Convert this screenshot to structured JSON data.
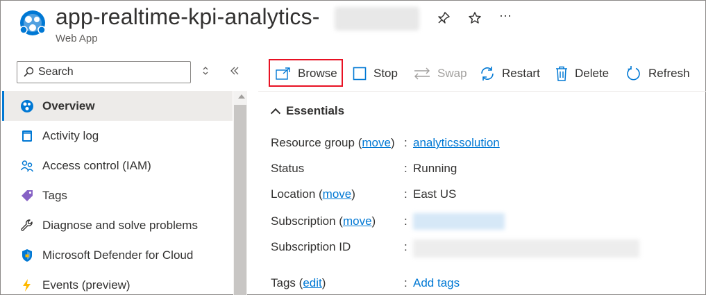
{
  "header": {
    "title": "app-realtime-kpi-analytics-",
    "subtitle": "Web App",
    "pin_icon": "pin-icon",
    "star_icon": "star-icon",
    "more_icon": "ellipsis-icon",
    "more_glyph": "···"
  },
  "sidebar": {
    "search_placeholder": "Search",
    "items": [
      {
        "label": "Overview",
        "icon": "overview-globe-icon",
        "active": true
      },
      {
        "label": "Activity log",
        "icon": "activity-log-icon"
      },
      {
        "label": "Access control (IAM)",
        "icon": "people-icon"
      },
      {
        "label": "Tags",
        "icon": "tag-icon"
      },
      {
        "label": "Diagnose and solve problems",
        "icon": "wrench-icon"
      },
      {
        "label": "Microsoft Defender for Cloud",
        "icon": "shield-icon"
      },
      {
        "label": "Events (preview)",
        "icon": "lightning-icon"
      }
    ]
  },
  "toolbar": {
    "browse": "Browse",
    "stop": "Stop",
    "swap": "Swap",
    "restart": "Restart",
    "delete": "Delete",
    "refresh": "Refresh"
  },
  "essentials": {
    "heading": "Essentials",
    "rows": [
      {
        "key": "Resource group",
        "key_link": "move",
        "value": "analyticssolution",
        "value_is_link": true
      },
      {
        "key": "Status",
        "value": "Running"
      },
      {
        "key": "Location",
        "key_link": "move",
        "value": "East US"
      },
      {
        "key": "Subscription",
        "key_link": "move",
        "value": ""
      },
      {
        "key": "Subscription ID",
        "value": ""
      },
      {
        "key": "Tags",
        "key_link": "edit",
        "value": "Add tags",
        "value_is_link": true
      }
    ]
  },
  "colors": {
    "accent": "#0078d4",
    "highlight": "#e81123"
  }
}
